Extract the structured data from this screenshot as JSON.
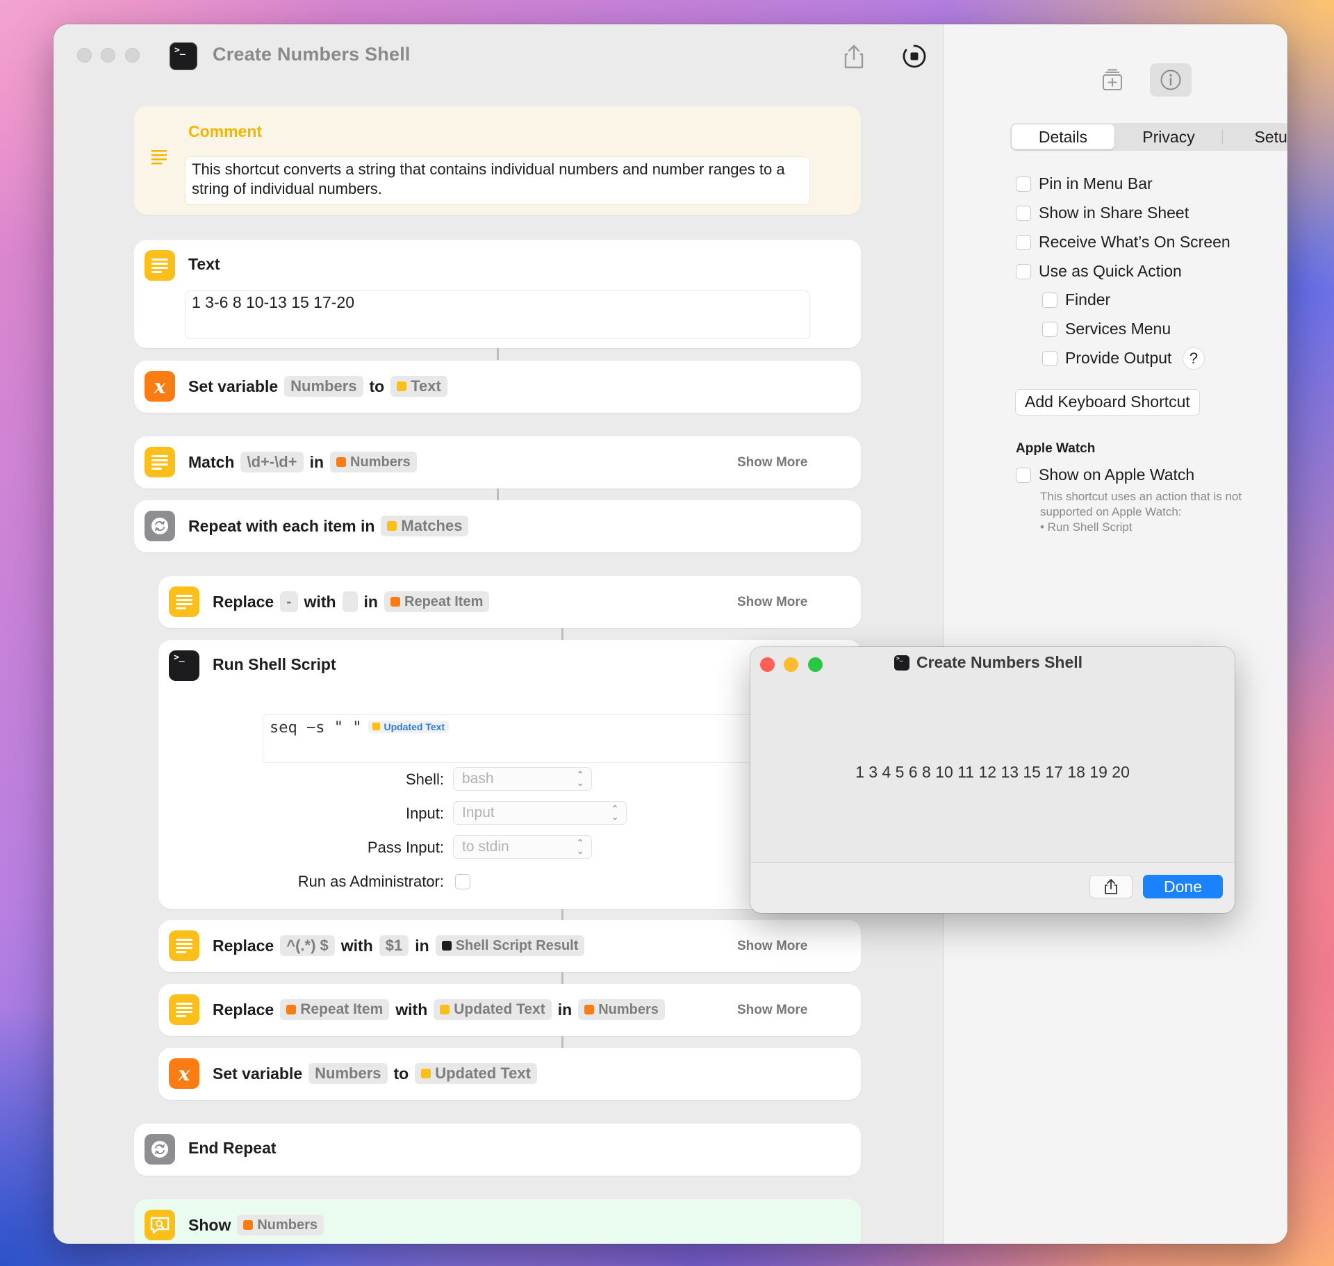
{
  "window": {
    "title": "Create Numbers Shell"
  },
  "actions": {
    "comment": {
      "title": "Comment",
      "text": "This shortcut converts a string that contains individual numbers and number ranges to a string of individual numbers."
    },
    "text": {
      "title": "Text",
      "value": "1 3-6 8 10-13 15 17-20"
    },
    "set_var1": {
      "label": "Set variable",
      "var": "Numbers",
      "to": "to",
      "value": "Text"
    },
    "match": {
      "label": "Match",
      "pattern": "\\d+-\\d+",
      "in": "in",
      "source": "Numbers",
      "show_more": "Show More"
    },
    "repeat": {
      "label": "Repeat with each item in",
      "source": "Matches"
    },
    "replace1": {
      "label": "Replace",
      "find": "-",
      "with": "with",
      "replace": "",
      "in": "in",
      "source": "Repeat Item",
      "show_more": "Show More"
    },
    "shell": {
      "title": "Run Shell Script",
      "script": "seq −s \" \"",
      "script_token": "Updated Text",
      "shell_label": "Shell:",
      "shell_value": "bash",
      "input_label": "Input:",
      "input_value": "Input",
      "pass_label": "Pass Input:",
      "pass_value": "to stdin",
      "admin_label": "Run as Administrator:"
    },
    "replace2": {
      "label": "Replace",
      "find": "^(.*) $",
      "with": "with",
      "replace": "$1",
      "in": "in",
      "source": "Shell Script Result",
      "show_more": "Show More"
    },
    "replace3": {
      "label": "Replace",
      "find": "Repeat Item",
      "with": "with",
      "replace": "Updated Text",
      "in": "in",
      "source": "Numbers",
      "show_more": "Show More"
    },
    "set_var2": {
      "label": "Set variable",
      "var": "Numbers",
      "to": "to",
      "value": "Updated Text"
    },
    "end_repeat": {
      "label": "End Repeat"
    },
    "show": {
      "label": "Show",
      "source": "Numbers"
    }
  },
  "inspector": {
    "tabs": [
      "Details",
      "Privacy",
      "Setup"
    ],
    "options": {
      "pin_menu_bar": "Pin in Menu Bar",
      "share_sheet": "Show in Share Sheet",
      "receive_screen": "Receive What’s On Screen",
      "quick_action": "Use as Quick Action",
      "finder": "Finder",
      "services": "Services Menu",
      "provide_output": "Provide Output",
      "help": "?"
    },
    "add_shortcut": "Add Keyboard Shortcut",
    "apple_watch": {
      "title": "Apple Watch",
      "show": "Show on Apple Watch",
      "note1": "This shortcut uses an action that is not",
      "note2": "supported on Apple Watch:",
      "note3": "• Run Shell Script"
    }
  },
  "result_window": {
    "title": "Create Numbers Shell",
    "output": "1 3 4 5 6 8 10 11 12 13 15 17 18 19 20",
    "done": "Done"
  },
  "colors": {
    "accent_blue": "#1a82fb",
    "yellow_icon": "#fcbf1a",
    "orange_icon": "#fb7c12",
    "comment_bg": "#faf5e6",
    "show_bg": "#eafcf0"
  }
}
